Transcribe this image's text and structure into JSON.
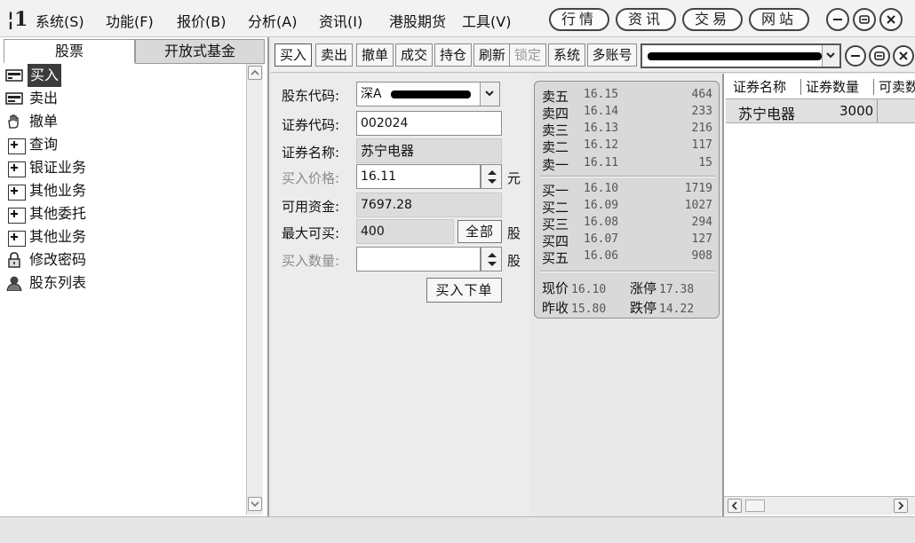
{
  "menubar": {
    "items": [
      "系统(S)",
      "功能(F)",
      "报价(B)",
      "分析(A)",
      "资讯(I)",
      "港股期货",
      "工具(V)"
    ],
    "pills": [
      "行情",
      "资讯",
      "交易",
      "网站"
    ]
  },
  "left_panel": {
    "tabs": [
      "股票",
      "开放式基金"
    ],
    "tree": [
      {
        "label": "买入",
        "icon": "buy-icon",
        "selected": true
      },
      {
        "label": "卖出",
        "icon": "sell-icon"
      },
      {
        "label": "撤单",
        "icon": "hand-icon"
      },
      {
        "label": "查询",
        "icon": "expand-icon"
      },
      {
        "label": "银证业务",
        "icon": "expand-icon"
      },
      {
        "label": "其他业务",
        "icon": "expand-icon"
      },
      {
        "label": "其他委托",
        "icon": "expand-icon"
      },
      {
        "label": "其他业务",
        "icon": "expand-icon"
      },
      {
        "label": "修改密码",
        "icon": "lock-icon"
      },
      {
        "label": "股东列表",
        "icon": "user-icon"
      }
    ]
  },
  "toolbar": {
    "buttons": [
      "买入",
      "卖出",
      "撤单",
      "成交",
      "持仓",
      "刷新",
      "锁定",
      "系统",
      "多账号"
    ],
    "disabled_index": 6,
    "active_index": 0
  },
  "order_form": {
    "shareholder_label": "股东代码:",
    "shareholder_prefix": "深A",
    "security_code_label": "证券代码:",
    "security_code": "002024",
    "security_name_label": "证券名称:",
    "security_name": "苏宁电器",
    "price_label": "买入价格:",
    "price": "16.11",
    "price_unit": "元",
    "funds_label": "可用资金:",
    "funds": "7697.28",
    "max_buy_label": "最大可买:",
    "max_buy": "400",
    "all_button": "全部",
    "share_unit": "股",
    "quantity_label": "买入数量:",
    "quantity": "",
    "submit_button": "买入下单"
  },
  "quote": {
    "asks": [
      {
        "label": "卖五",
        "price": "16.15",
        "volume": "464"
      },
      {
        "label": "卖四",
        "price": "16.14",
        "volume": "233"
      },
      {
        "label": "卖三",
        "price": "16.13",
        "volume": "216"
      },
      {
        "label": "卖二",
        "price": "16.12",
        "volume": "117"
      },
      {
        "label": "卖一",
        "price": "16.11",
        "volume": "15"
      }
    ],
    "bids": [
      {
        "label": "买一",
        "price": "16.10",
        "volume": "1719"
      },
      {
        "label": "买二",
        "price": "16.09",
        "volume": "1027"
      },
      {
        "label": "买三",
        "price": "16.08",
        "volume": "294"
      },
      {
        "label": "买四",
        "price": "16.07",
        "volume": "127"
      },
      {
        "label": "买五",
        "price": "16.06",
        "volume": "908"
      }
    ],
    "current_label": "现价",
    "current": "16.10",
    "limit_up_label": "涨停",
    "limit_up": "17.38",
    "prev_close_label": "昨收",
    "prev_close": "15.80",
    "limit_down_label": "跌停",
    "limit_down": "14.22"
  },
  "holdings": {
    "columns": [
      "证券名称",
      "证券数量",
      "可卖数"
    ],
    "rows": [
      {
        "name": "苏宁电器",
        "quantity": "3000"
      }
    ]
  }
}
